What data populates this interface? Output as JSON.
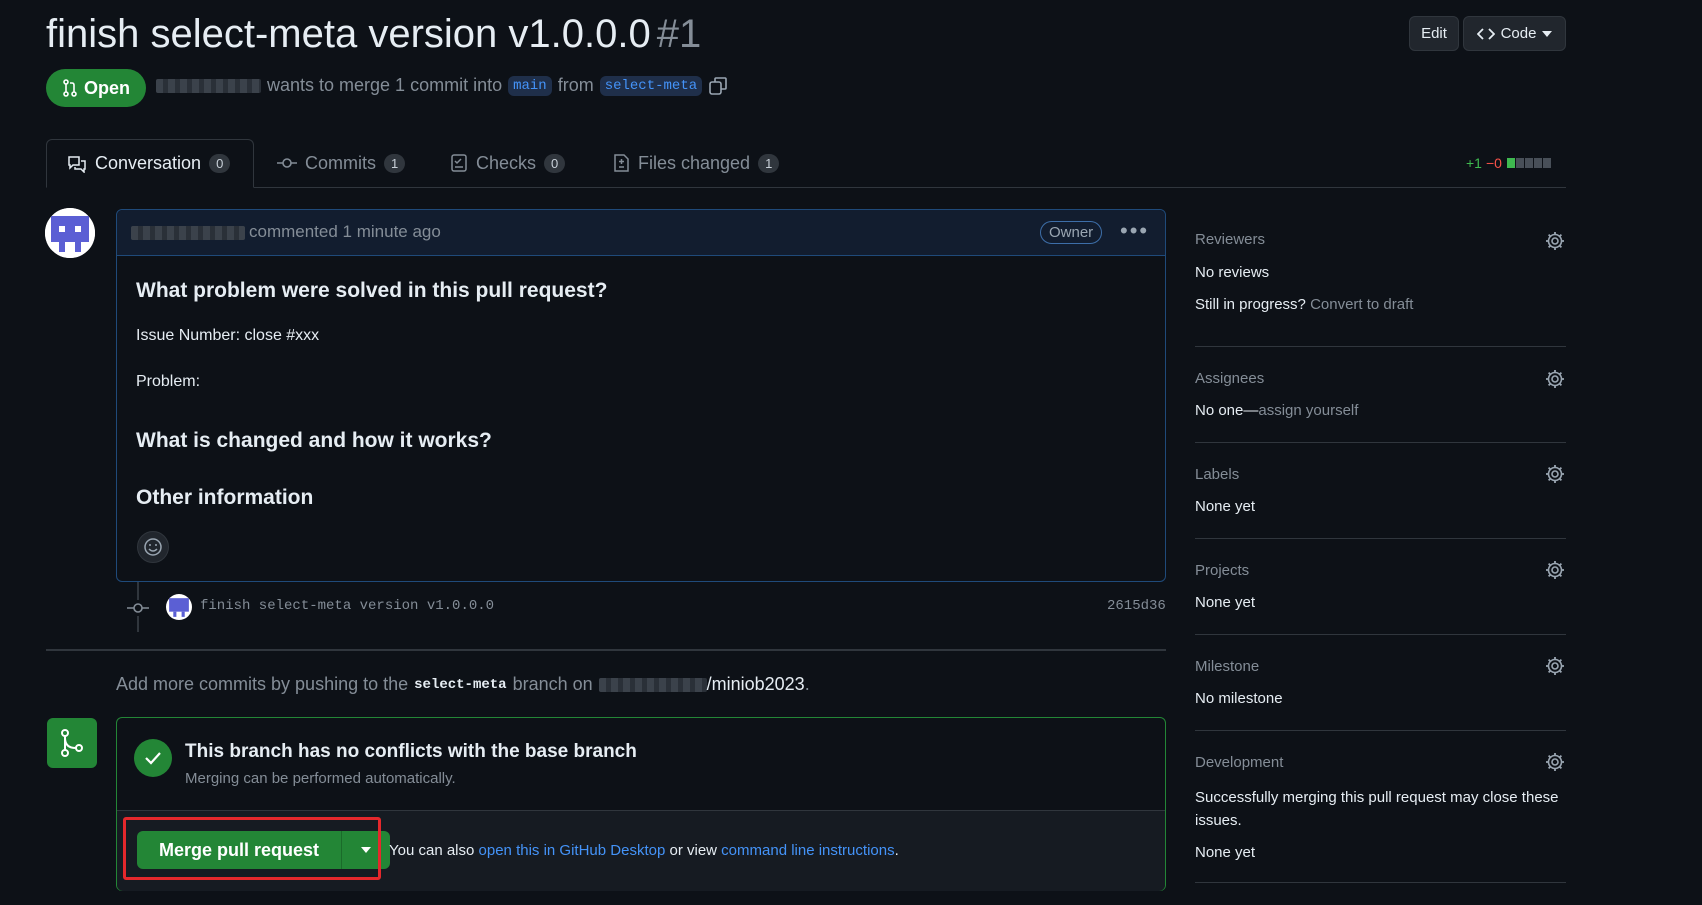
{
  "header": {
    "title": "finish select-meta version v1.0.0.0",
    "number": "#1",
    "edit_label": "Edit",
    "code_label": "Code",
    "state": "Open",
    "merge_text": "wants to merge 1 commit into",
    "base_branch": "main",
    "from_text": "from",
    "head_branch": "select-meta"
  },
  "tabs": [
    {
      "label": "Conversation",
      "count": "0"
    },
    {
      "label": "Commits",
      "count": "1"
    },
    {
      "label": "Checks",
      "count": "0"
    },
    {
      "label": "Files changed",
      "count": "1"
    }
  ],
  "diffstat": {
    "additions": "+1",
    "deletions": "−0"
  },
  "comment": {
    "meta": "commented 1 minute ago",
    "badge": "Owner",
    "heading1": "What problem were solved in this pull request?",
    "issue_line": "Issue Number: close #xxx",
    "problem_line": "Problem:",
    "heading2": "What is changed and how it works?",
    "heading3": "Other information"
  },
  "commit": {
    "message": "finish select-meta version v1.0.0.0",
    "sha": "2615d36"
  },
  "push_hint": {
    "prefix": "Add more commits by pushing to the",
    "branch": "select-meta",
    "middle": "branch on",
    "repo": "/miniob2023",
    "suffix": "."
  },
  "merge": {
    "status_title": "This branch has no conflicts with the base branch",
    "status_sub": "Merging can be performed automatically.",
    "button_label": "Merge pull request",
    "also_text": "You can also",
    "desktop_link": "open this in GitHub Desktop",
    "or_view": "or view",
    "cli_link": "command line instructions",
    "end": "."
  },
  "sidebar": {
    "reviewers": {
      "label": "Reviewers",
      "value": "No reviews",
      "draft_q": "Still in progress?",
      "draft_link": "Convert to draft"
    },
    "assignees": {
      "label": "Assignees",
      "value": "No one—",
      "assign_link": "assign yourself"
    },
    "labels": {
      "label": "Labels",
      "value": "None yet"
    },
    "projects": {
      "label": "Projects",
      "value": "None yet"
    },
    "milestone": {
      "label": "Milestone",
      "value": "No milestone"
    },
    "development": {
      "label": "Development",
      "text": "Successfully merging this pull request may close these issues.",
      "value": "None yet"
    }
  },
  "colors": {
    "accent": "#4493f8",
    "success": "#238636",
    "highlight": "#e5282c"
  }
}
